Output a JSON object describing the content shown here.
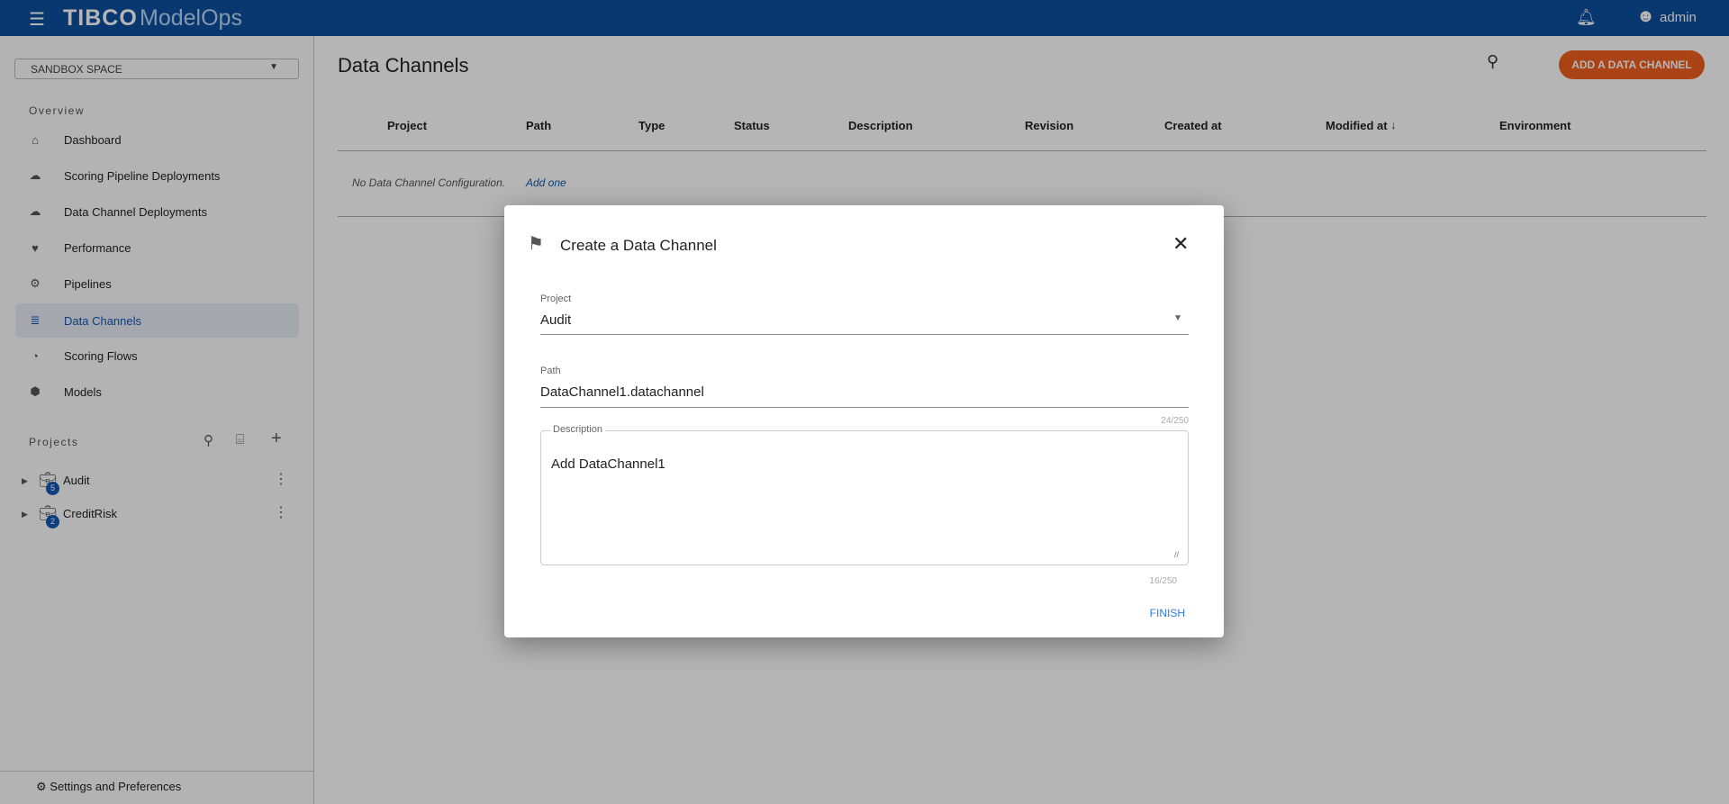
{
  "topbar": {
    "brand": "TIBCO",
    "product": "ModelOps",
    "user": "admin"
  },
  "sidebar": {
    "space": "SANDBOX SPACE",
    "overview_label": "Overview",
    "items": [
      {
        "label": "Dashboard",
        "icon": "home-icon"
      },
      {
        "label": "Scoring Pipeline Deployments",
        "icon": "cloud-upload-icon"
      },
      {
        "label": "Data Channel Deployments",
        "icon": "cloud-upload-icon"
      },
      {
        "label": "Performance",
        "icon": "heart-pulse-icon"
      },
      {
        "label": "Pipelines",
        "icon": "pipeline-icon"
      },
      {
        "label": "Data Channels",
        "icon": "database-icon",
        "active": true
      },
      {
        "label": "Scoring Flows",
        "icon": "gauge-icon"
      },
      {
        "label": "Models",
        "icon": "cube-icon"
      }
    ],
    "projects_label": "Projects",
    "projects": [
      {
        "name": "Audit",
        "count": "5"
      },
      {
        "name": "CreditRisk",
        "count": "2"
      }
    ],
    "settings": "Settings and Preferences"
  },
  "main": {
    "title": "Data Channels",
    "add_button": "ADD A DATA CHANNEL",
    "columns": [
      "Project",
      "Path",
      "Type",
      "Status",
      "Description",
      "Revision",
      "Created at",
      "Modified at",
      "Environment"
    ],
    "empty_text": "No Data Channel Configuration.",
    "add_one": "Add one"
  },
  "dialog": {
    "title": "Create a Data Channel",
    "project_label": "Project",
    "project_value": "Audit",
    "path_label": "Path",
    "path_value": "DataChannel1.datachannel",
    "path_count": "24/250",
    "description_label": "Description",
    "description_value": "Add DataChannel1",
    "description_count": "16/250",
    "finish": "FINISH"
  },
  "colors": {
    "topbar": "#0e4fa0",
    "accent": "#f0601f",
    "link": "#1556b5"
  }
}
